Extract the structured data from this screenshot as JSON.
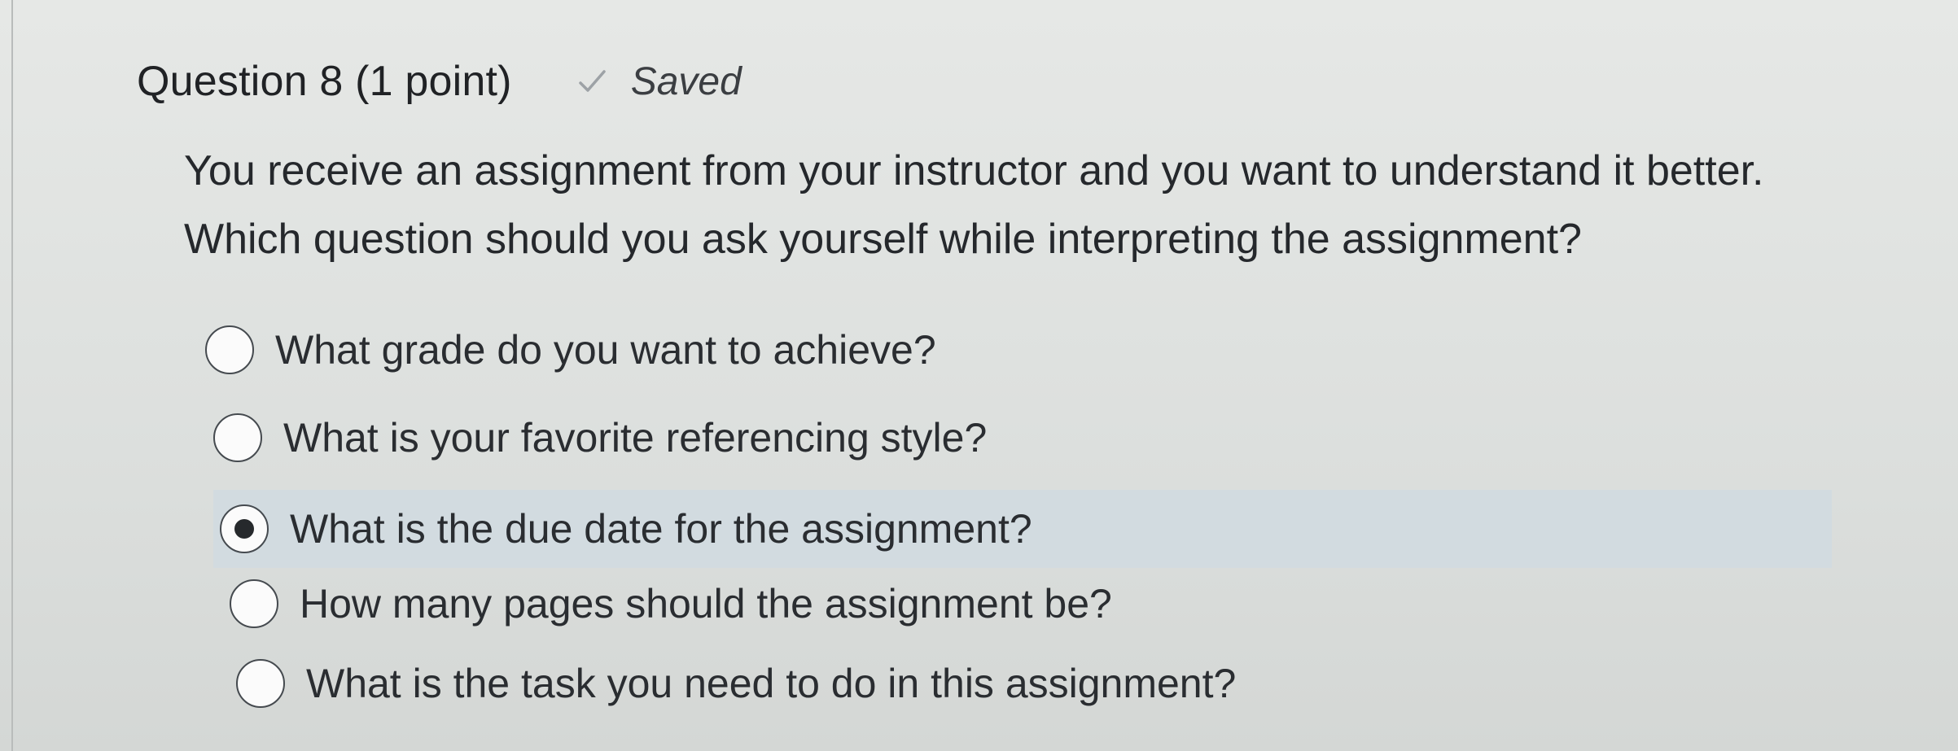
{
  "question": {
    "title": "Question 8 (1 point)",
    "status": "Saved",
    "status_icon": "checkmark-icon",
    "prompt_lines": [
      "You receive an assignment from your instructor and you want to understand it better.",
      "Which question should you ask yourself while interpreting the assignment?"
    ]
  },
  "options": [
    {
      "label": "What grade do you want to achieve?",
      "selected": false
    },
    {
      "label": "What is your favorite referencing style?",
      "selected": false
    },
    {
      "label": "What is the due date for the assignment?",
      "selected": true
    },
    {
      "label": "How many pages should the assignment be?",
      "selected": false
    },
    {
      "label": "What is the task you need to do in this assignment?",
      "selected": false
    }
  ],
  "colors": {
    "selected_row": "#d2dbe0",
    "text": "#2a2d31",
    "radio_border": "#454a4f"
  }
}
